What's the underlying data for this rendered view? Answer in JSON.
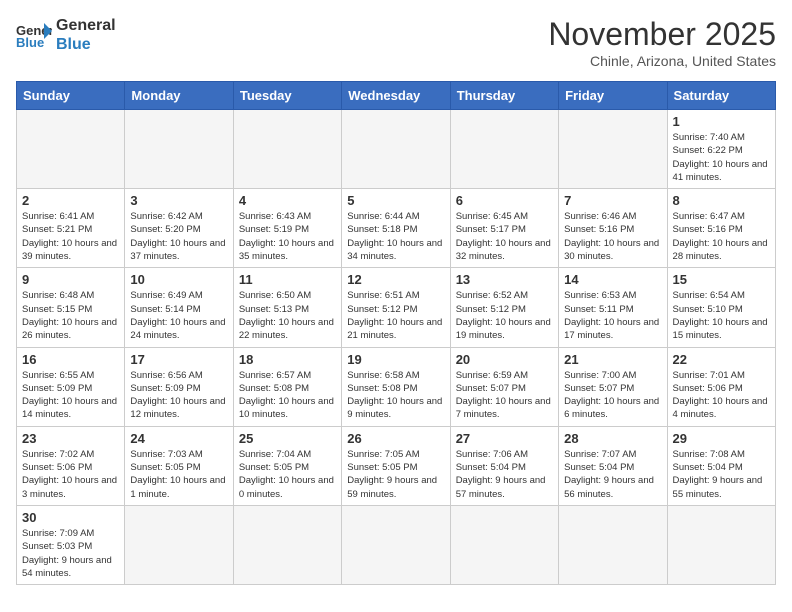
{
  "header": {
    "logo_general": "General",
    "logo_blue": "Blue",
    "month": "November 2025",
    "location": "Chinle, Arizona, United States"
  },
  "weekdays": [
    "Sunday",
    "Monday",
    "Tuesday",
    "Wednesday",
    "Thursday",
    "Friday",
    "Saturday"
  ],
  "weeks": [
    [
      {
        "day": "",
        "info": ""
      },
      {
        "day": "",
        "info": ""
      },
      {
        "day": "",
        "info": ""
      },
      {
        "day": "",
        "info": ""
      },
      {
        "day": "",
        "info": ""
      },
      {
        "day": "",
        "info": ""
      },
      {
        "day": "1",
        "info": "Sunrise: 7:40 AM\nSunset: 6:22 PM\nDaylight: 10 hours and 41 minutes."
      }
    ],
    [
      {
        "day": "2",
        "info": "Sunrise: 6:41 AM\nSunset: 5:21 PM\nDaylight: 10 hours and 39 minutes."
      },
      {
        "day": "3",
        "info": "Sunrise: 6:42 AM\nSunset: 5:20 PM\nDaylight: 10 hours and 37 minutes."
      },
      {
        "day": "4",
        "info": "Sunrise: 6:43 AM\nSunset: 5:19 PM\nDaylight: 10 hours and 35 minutes."
      },
      {
        "day": "5",
        "info": "Sunrise: 6:44 AM\nSunset: 5:18 PM\nDaylight: 10 hours and 34 minutes."
      },
      {
        "day": "6",
        "info": "Sunrise: 6:45 AM\nSunset: 5:17 PM\nDaylight: 10 hours and 32 minutes."
      },
      {
        "day": "7",
        "info": "Sunrise: 6:46 AM\nSunset: 5:16 PM\nDaylight: 10 hours and 30 minutes."
      },
      {
        "day": "8",
        "info": "Sunrise: 6:47 AM\nSunset: 5:16 PM\nDaylight: 10 hours and 28 minutes."
      }
    ],
    [
      {
        "day": "9",
        "info": "Sunrise: 6:48 AM\nSunset: 5:15 PM\nDaylight: 10 hours and 26 minutes."
      },
      {
        "day": "10",
        "info": "Sunrise: 6:49 AM\nSunset: 5:14 PM\nDaylight: 10 hours and 24 minutes."
      },
      {
        "day": "11",
        "info": "Sunrise: 6:50 AM\nSunset: 5:13 PM\nDaylight: 10 hours and 22 minutes."
      },
      {
        "day": "12",
        "info": "Sunrise: 6:51 AM\nSunset: 5:12 PM\nDaylight: 10 hours and 21 minutes."
      },
      {
        "day": "13",
        "info": "Sunrise: 6:52 AM\nSunset: 5:12 PM\nDaylight: 10 hours and 19 minutes."
      },
      {
        "day": "14",
        "info": "Sunrise: 6:53 AM\nSunset: 5:11 PM\nDaylight: 10 hours and 17 minutes."
      },
      {
        "day": "15",
        "info": "Sunrise: 6:54 AM\nSunset: 5:10 PM\nDaylight: 10 hours and 15 minutes."
      }
    ],
    [
      {
        "day": "16",
        "info": "Sunrise: 6:55 AM\nSunset: 5:09 PM\nDaylight: 10 hours and 14 minutes."
      },
      {
        "day": "17",
        "info": "Sunrise: 6:56 AM\nSunset: 5:09 PM\nDaylight: 10 hours and 12 minutes."
      },
      {
        "day": "18",
        "info": "Sunrise: 6:57 AM\nSunset: 5:08 PM\nDaylight: 10 hours and 10 minutes."
      },
      {
        "day": "19",
        "info": "Sunrise: 6:58 AM\nSunset: 5:08 PM\nDaylight: 10 hours and 9 minutes."
      },
      {
        "day": "20",
        "info": "Sunrise: 6:59 AM\nSunset: 5:07 PM\nDaylight: 10 hours and 7 minutes."
      },
      {
        "day": "21",
        "info": "Sunrise: 7:00 AM\nSunset: 5:07 PM\nDaylight: 10 hours and 6 minutes."
      },
      {
        "day": "22",
        "info": "Sunrise: 7:01 AM\nSunset: 5:06 PM\nDaylight: 10 hours and 4 minutes."
      }
    ],
    [
      {
        "day": "23",
        "info": "Sunrise: 7:02 AM\nSunset: 5:06 PM\nDaylight: 10 hours and 3 minutes."
      },
      {
        "day": "24",
        "info": "Sunrise: 7:03 AM\nSunset: 5:05 PM\nDaylight: 10 hours and 1 minute."
      },
      {
        "day": "25",
        "info": "Sunrise: 7:04 AM\nSunset: 5:05 PM\nDaylight: 10 hours and 0 minutes."
      },
      {
        "day": "26",
        "info": "Sunrise: 7:05 AM\nSunset: 5:05 PM\nDaylight: 9 hours and 59 minutes."
      },
      {
        "day": "27",
        "info": "Sunrise: 7:06 AM\nSunset: 5:04 PM\nDaylight: 9 hours and 57 minutes."
      },
      {
        "day": "28",
        "info": "Sunrise: 7:07 AM\nSunset: 5:04 PM\nDaylight: 9 hours and 56 minutes."
      },
      {
        "day": "29",
        "info": "Sunrise: 7:08 AM\nSunset: 5:04 PM\nDaylight: 9 hours and 55 minutes."
      }
    ],
    [
      {
        "day": "30",
        "info": "Sunrise: 7:09 AM\nSunset: 5:03 PM\nDaylight: 9 hours and 54 minutes."
      },
      {
        "day": "",
        "info": ""
      },
      {
        "day": "",
        "info": ""
      },
      {
        "day": "",
        "info": ""
      },
      {
        "day": "",
        "info": ""
      },
      {
        "day": "",
        "info": ""
      },
      {
        "day": "",
        "info": ""
      }
    ]
  ]
}
